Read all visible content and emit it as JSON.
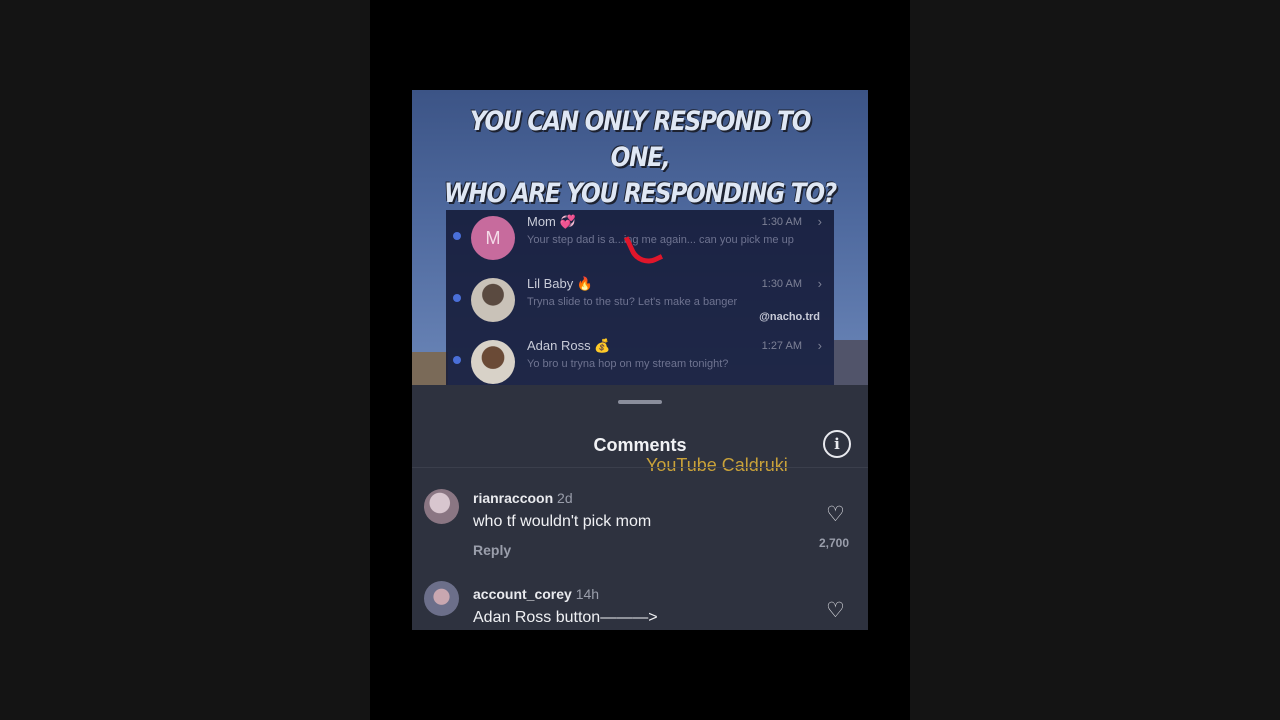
{
  "post": {
    "headline_line1": "YOU CAN ONLY RESPOND TO ONE,",
    "headline_line2": "WHO ARE YOU RESPONDING TO?",
    "messages": [
      {
        "name": "Mom 💞",
        "initial": "M",
        "time": "1:30 AM",
        "chevron": "›",
        "preview": "Your step dad is a...ing me again... can you pick me up"
      },
      {
        "name": "Lil Baby 🔥",
        "time": "1:30 AM",
        "chevron": "›",
        "preview": "Tryna slide to the stu? Let's make a banger",
        "tag": "@nacho.trd"
      },
      {
        "name": "Adan Ross 💰",
        "time": "1:27 AM",
        "chevron": "›",
        "preview": "Yo bro u tryna hop on my stream tonight?"
      }
    ]
  },
  "sheet": {
    "title": "Comments",
    "info_icon": "i",
    "watermark": "YouTube Caldruki"
  },
  "comments": [
    {
      "user": "rianraccoon",
      "age": "2d",
      "text": "who tf wouldn't pick mom",
      "reply": "Reply",
      "heart": "♡",
      "likes": "2,700"
    },
    {
      "user": "account_corey",
      "age": "14h",
      "text": "Adan Ross button———>",
      "heart": "♡"
    }
  ],
  "colors": {
    "accent_mark": "#e0162b",
    "watermark": "#c9a23a",
    "unread_dot": "#4a6fd8"
  }
}
